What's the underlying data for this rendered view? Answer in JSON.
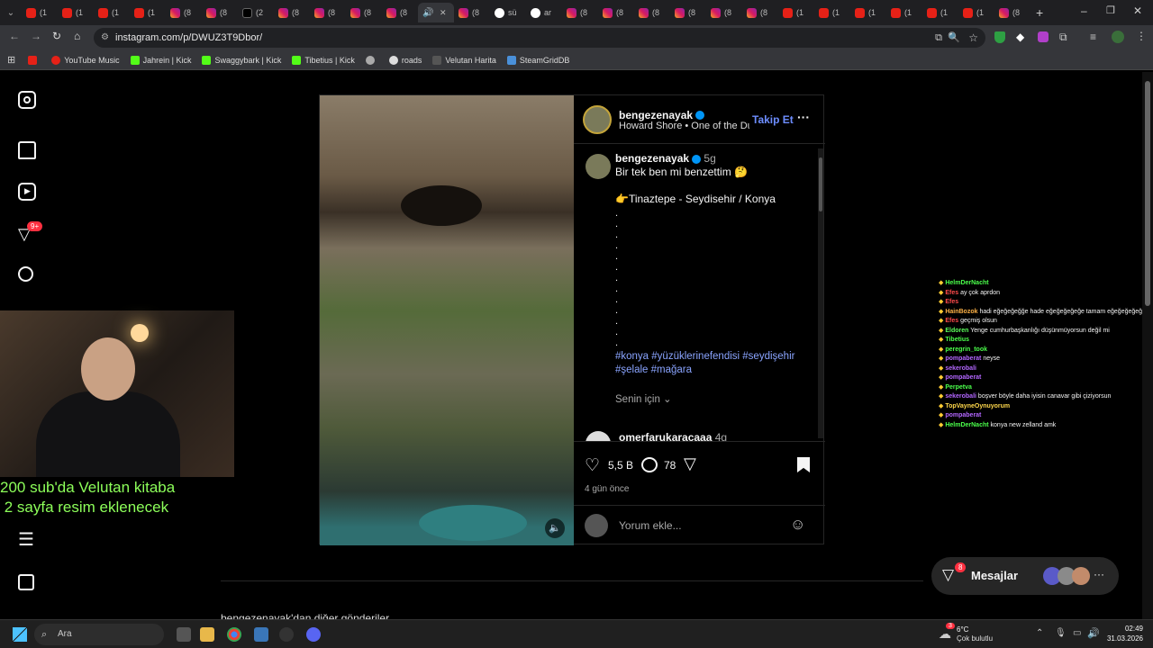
{
  "browser": {
    "tabs": [
      {
        "icon": "youtube-icon",
        "label": "(1"
      },
      {
        "icon": "youtube-icon",
        "label": "(1"
      },
      {
        "icon": "youtube-icon",
        "label": "(1"
      },
      {
        "icon": "youtube-icon",
        "label": "(1"
      },
      {
        "icon": "instagram-icon",
        "label": "(8"
      },
      {
        "icon": "instagram-icon",
        "label": "(8"
      },
      {
        "icon": "x-icon",
        "label": "(2"
      },
      {
        "icon": "instagram-icon",
        "label": "(8"
      },
      {
        "icon": "instagram-icon",
        "label": "(8"
      },
      {
        "icon": "instagram-icon",
        "label": "(8"
      },
      {
        "icon": "instagram-icon",
        "label": "(8"
      },
      {
        "icon": "audio-icon",
        "label": ""
      },
      {
        "icon": "instagram-icon",
        "label": "(8"
      },
      {
        "icon": "google-icon",
        "label": "sü"
      },
      {
        "icon": "google-icon",
        "label": "ar"
      },
      {
        "icon": "instagram-icon",
        "label": "(8"
      },
      {
        "icon": "instagram-icon",
        "label": "(8"
      },
      {
        "icon": "instagram-icon",
        "label": "(8"
      },
      {
        "icon": "instagram-icon",
        "label": "(8"
      },
      {
        "icon": "instagram-icon",
        "label": "(8"
      },
      {
        "icon": "instagram-icon",
        "label": "(8"
      },
      {
        "icon": "youtube-icon",
        "label": "(1"
      },
      {
        "icon": "youtube-icon",
        "label": "(1"
      },
      {
        "icon": "youtube-icon",
        "label": "(1"
      },
      {
        "icon": "youtube-icon",
        "label": "(1"
      },
      {
        "icon": "youtube-icon",
        "label": "(1"
      },
      {
        "icon": "youtube-icon",
        "label": "(1"
      },
      {
        "icon": "instagram-icon",
        "label": "(8"
      }
    ],
    "url": "instagram.com/p/DWUZ3T9Dbor/",
    "bookmarks": [
      {
        "label": "",
        "icon": "youtube-icon"
      },
      {
        "label": "YouTube Music",
        "icon": "youtube-music-icon"
      },
      {
        "label": "Jahrein | Kick",
        "icon": "kick-icon"
      },
      {
        "label": "Swaggybark | Kick",
        "icon": "kick-icon"
      },
      {
        "label": "Tibetius | Kick",
        "icon": "kick-icon"
      },
      {
        "label": "",
        "icon": "globe-icon"
      },
      {
        "label": "roads",
        "icon": "roads-icon"
      },
      {
        "label": "Velutan Harita",
        "icon": "map-icon"
      },
      {
        "label": "SteamGridDB",
        "icon": "steamgrid-icon"
      }
    ]
  },
  "sidebar": {
    "badge": "9+"
  },
  "overlay": {
    "line1": "200 sub'da Velutan kitaba",
    "line2": " 2 sayfa resim eklenecek"
  },
  "post": {
    "username": "bengezenayak",
    "audio": "Howard Shore • One of the Dú...",
    "follow": "Takip Et",
    "caption_age": "5g",
    "caption_line1": "Bir tek ben mi benzettim 🤔",
    "caption_location": "👉Tinaztepe - Seydisehir / Konya",
    "hashtags": "#konya #yüzüklerinefendisi #seydişehir #şelale #mağara",
    "for_you": "Senin için ⌄",
    "commenter": "omerfarukaracaaa",
    "commenter_age": "4g",
    "likes": "5,5 B",
    "comments": "78",
    "time": "4 gün önce",
    "comment_placeholder": "Yorum ekle...",
    "more_posts": "bengezenayak'dan diğer gönderiler"
  },
  "chat": [
    {
      "user": "HelmDerNacht",
      "color": "#4bff4b",
      "msg": ""
    },
    {
      "user": "Efes",
      "color": "#ff4b4b",
      "msg": "ay çok aprdon"
    },
    {
      "user": "Efes",
      "color": "#ff4b4b",
      "msg": ""
    },
    {
      "user": "HainBozok",
      "color": "#ffb347",
      "msg": "hadi eğeğeğeğğe hade eğeğeğeğeğe tamam eğeğeğeğeğ"
    },
    {
      "user": "Efes",
      "color": "#ff4b4b",
      "msg": "geçmiş olsun"
    },
    {
      "user": "Eldoren",
      "color": "#5cff5c",
      "msg": "Yenge cumhurbaşkanlığı düşünmüyorsun değil mi"
    },
    {
      "user": "Tibetius",
      "color": "#4bff4b",
      "msg": ""
    },
    {
      "user": "peregrin_took",
      "color": "#4bff4b",
      "msg": ""
    },
    {
      "user": "pompaberat",
      "color": "#b366ff",
      "msg": "neyse"
    },
    {
      "user": "sekerobali",
      "color": "#b366ff",
      "msg": ""
    },
    {
      "user": "pompaberat",
      "color": "#b366ff",
      "msg": ""
    },
    {
      "user": "Perpetva",
      "color": "#4bff4b",
      "msg": ""
    },
    {
      "user": "sekerobali",
      "color": "#b366ff",
      "msg": "boşver böyle daha iyisin canavar gibi çiziyorsun"
    },
    {
      "user": "TopVayneOynuyorum",
      "color": "#ffd84b",
      "msg": ""
    },
    {
      "user": "pompaberat",
      "color": "#b366ff",
      "msg": ""
    },
    {
      "user": "HelmDerNacht",
      "color": "#4bff4b",
      "msg": "konya new zelland amk"
    }
  ],
  "messages": {
    "label": "Mesajlar",
    "badge": "8"
  },
  "taskbar": {
    "search": "Ara",
    "weather_temp": "6°C",
    "weather_desc": "Çok bulutlu",
    "weather_badge": "3",
    "time": "02:49",
    "date": "31.03.2026"
  }
}
